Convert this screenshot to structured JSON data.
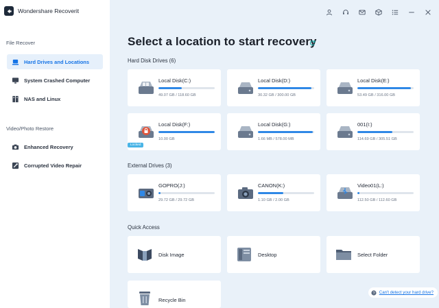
{
  "app": {
    "title": "Wondershare Recoverit"
  },
  "sidebar": {
    "section_file": "File Recover",
    "section_video": "Video/Photo Restore",
    "items": [
      {
        "label": "Hard Drives and Locations",
        "icon": "hard-drive-icon"
      },
      {
        "label": "System Crashed Computer",
        "icon": "monitor-icon"
      },
      {
        "label": "NAS and Linux",
        "icon": "nas-icon"
      },
      {
        "label": "Enhanced Recovery",
        "icon": "camera-icon"
      },
      {
        "label": "Corrupted Video Repair",
        "icon": "video-repair-icon"
      }
    ]
  },
  "topbar": {
    "icons": [
      "user-icon",
      "headset-icon",
      "mail-icon",
      "box-icon",
      "list-icon",
      "minimize-icon",
      "close-icon"
    ]
  },
  "main": {
    "title": "Select a location to start recovery",
    "hard_disk": {
      "label": "Hard Disk Drives (6)",
      "drives": [
        {
          "name": "Local Disk(C:)",
          "size": "49.07 GB / 118.60 GB",
          "used_fraction": 0.41
        },
        {
          "name": "Local Disk(D:)",
          "size": "30.32 GB / 300.00 GB",
          "used_fraction": 0.95
        },
        {
          "name": "Local Disk(E:)",
          "size": "53.49 GB / 316.00 GB",
          "used_fraction": 0.95
        },
        {
          "name": "Local Disk(F:)",
          "size": "10.00 GB",
          "used_fraction": 1.0,
          "badge": "Locked"
        },
        {
          "name": "Local Disk(G:)",
          "size": "1.66 MB / 578.00 MB",
          "used_fraction": 0.98
        },
        {
          "name": "001(I:)",
          "size": "114.69 GB / 305.51 GB",
          "used_fraction": 0.62
        }
      ]
    },
    "external": {
      "label": "External Drives (3)",
      "drives": [
        {
          "name": "GOPRO(J:)",
          "size": "29.72 GB / 29.72 GB",
          "used_fraction": 0.04
        },
        {
          "name": "CANON(K:)",
          "size": "1.10 GB / 2.00 GB",
          "used_fraction": 0.45
        },
        {
          "name": "Video01(L:)",
          "size": "112.50 GB / 112.60 GB",
          "used_fraction": 0.04
        }
      ]
    },
    "quick_access": {
      "label": "Quick Access",
      "items": [
        {
          "name": "Disk Image",
          "icon": "disk-image-icon"
        },
        {
          "name": "Desktop",
          "icon": "desktop-icon"
        },
        {
          "name": "Select Folder",
          "icon": "folder-icon"
        },
        {
          "name": "Recycle Bin",
          "icon": "recycle-bin-icon"
        }
      ]
    },
    "help": {
      "text": "Can't detect your hard drive?"
    }
  },
  "colors": {
    "accent": "#1473e6",
    "bar": "#2f88e6",
    "background": "#e9f1f9"
  }
}
